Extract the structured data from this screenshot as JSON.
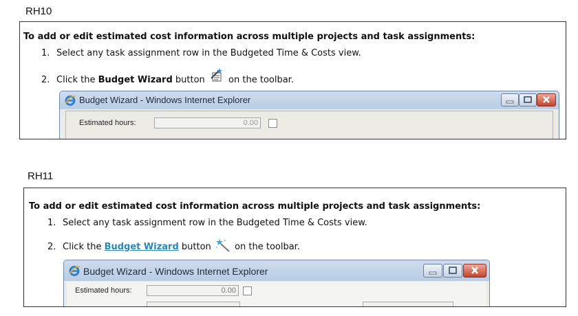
{
  "rh10": {
    "version": "RH10",
    "heading": "To add or edit estimated cost information across multiple projects and task assignments:",
    "step1_num": "1.",
    "step1_text": "Select any task assignment row in the Budgeted Time & Costs view.",
    "step2_num": "2.",
    "step2_before": "Click the ",
    "step2_link": "Budget Wizard",
    "step2_mid": " button ",
    "step2_after": " on the toolbar.",
    "window_title": "Budget Wizard - Windows Internet Explorer",
    "estimated_hours_label": "Estimated hours:",
    "estimated_hours_value": "0.00"
  },
  "rh11": {
    "version": "RH11",
    "heading": "To add or edit estimated cost information across multiple projects and task assignments:",
    "step1_num": "1.",
    "step1_text": "Select any task assignment row in the Budgeted Time & Costs view.",
    "step2_num": "2.",
    "step2_before": "Click the ",
    "step2_link": "Budget Wizard",
    "step2_mid": " button ",
    "step2_after": " on the toolbar.",
    "window_title": "Budget Wizard - Windows Internet Explorer",
    "estimated_hours_label": "Estimated hours:",
    "estimated_hours_value": "0.00"
  },
  "colors": {
    "link": "#2a88b8",
    "titlebar": "#c3d4e8",
    "window_body": "#ecebe6",
    "close_button": "#c4442d"
  },
  "icons": [
    "budget-wizard-toolbar-icon",
    "magic-wand-icon",
    "internet-explorer-icon",
    "minimize-icon",
    "maximize-icon",
    "close-icon",
    "checkbox-icon"
  ]
}
